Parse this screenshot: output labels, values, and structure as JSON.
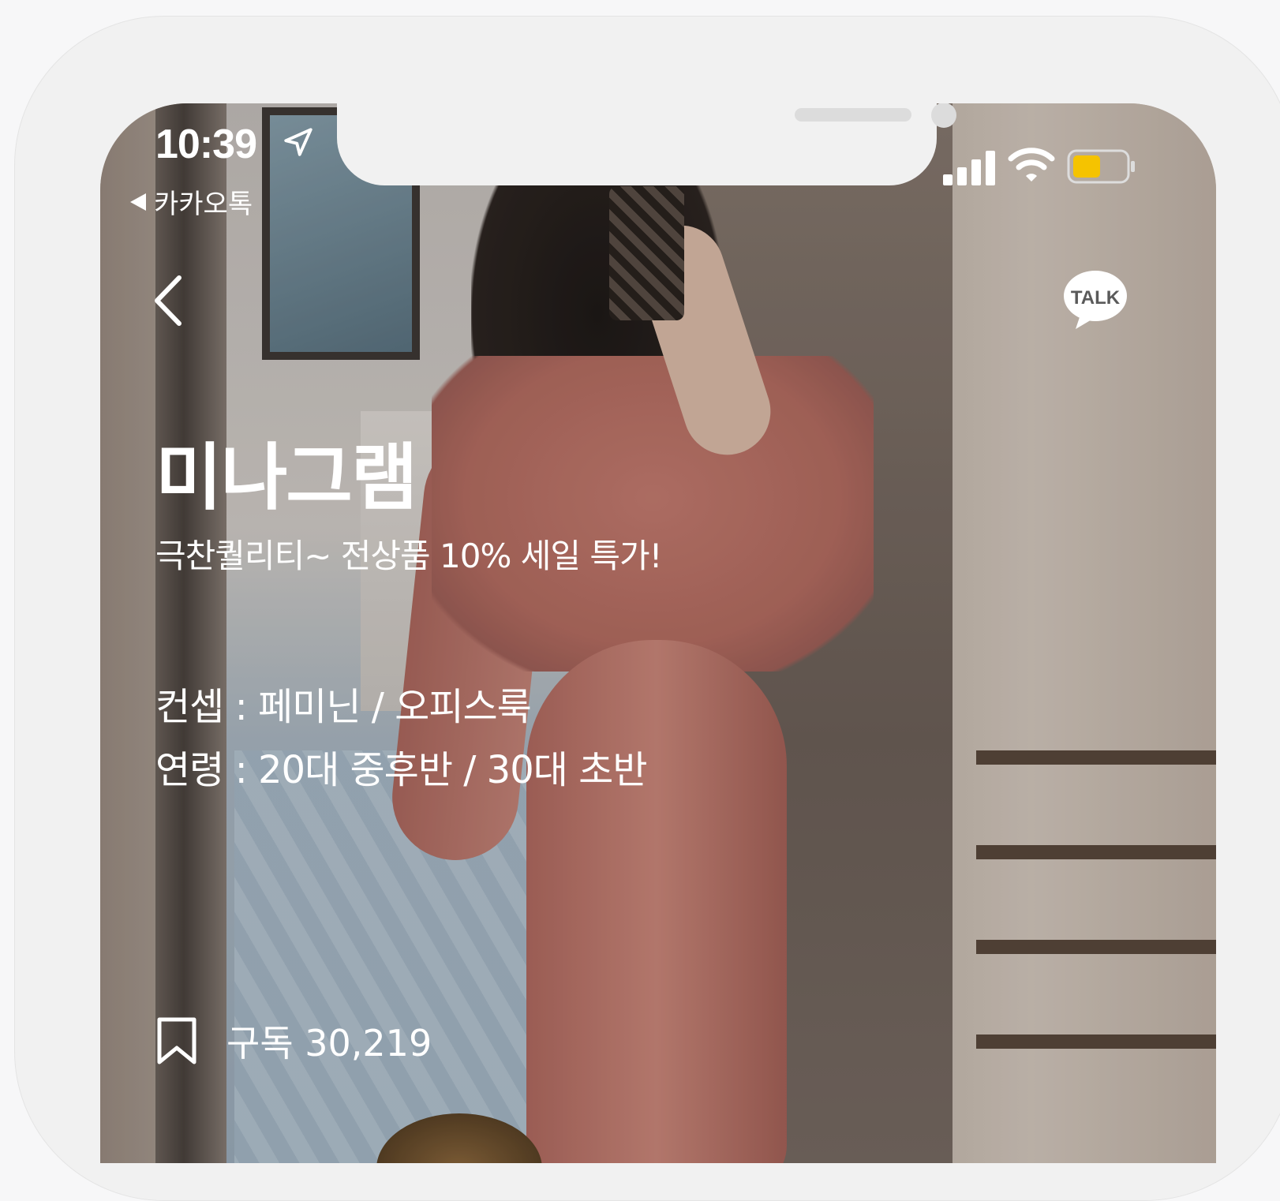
{
  "status_bar": {
    "time": "10:39",
    "back_app": "카카오톡",
    "battery_color": "#f5c300"
  },
  "nav": {
    "back_icon": "chevron-left-icon",
    "talk_label": "TALK"
  },
  "shop": {
    "title": "미나그램",
    "subtitle": "극찬퀄리티~ 전상품 10% 세일 특가!",
    "concept": "컨셉 : 페미닌 / 오피스룩",
    "age": "연령 : 20대 중후반 / 30대 초반",
    "subscribe": "구독 30,219"
  }
}
